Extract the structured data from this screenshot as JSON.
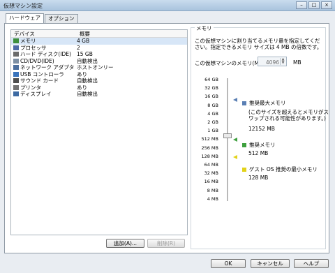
{
  "window": {
    "title": "仮想マシン設定",
    "minimize": "–",
    "maximize": "□",
    "close": "×"
  },
  "tabs": [
    {
      "label": "ハードウェア"
    },
    {
      "label": "オプション"
    }
  ],
  "devices": {
    "header": {
      "device": "デバイス",
      "summary": "概要"
    },
    "rows": [
      {
        "icon": "memory-icon",
        "device": "メモリ",
        "summary": "4 GB",
        "color": "#3e8f3e"
      },
      {
        "icon": "cpu-icon",
        "device": "プロセッサ",
        "summary": "2",
        "color": "#4e6aa7"
      },
      {
        "icon": "harddisk-icon",
        "device": "ハード ディスク(IDE)",
        "summary": "15 GB",
        "color": "#6b6b6b"
      },
      {
        "icon": "cd-dvd-icon",
        "device": "CD/DVD(IDE)",
        "summary": "自動検出",
        "color": "#7d8fa3"
      },
      {
        "icon": "network-adapter-icon",
        "device": "ネットワーク アダプタ",
        "summary": "ホストオンリー",
        "color": "#4d6f9d"
      },
      {
        "icon": "usb-icon",
        "device": "USB コントローラ",
        "summary": "あり",
        "color": "#3a74bc"
      },
      {
        "icon": "sound-card-icon",
        "device": "サウンド カード",
        "summary": "自動検出",
        "color": "#4f4f4f"
      },
      {
        "icon": "printer-icon",
        "device": "プリンタ",
        "summary": "あり",
        "color": "#737373"
      },
      {
        "icon": "display-icon",
        "device": "ディスプレイ",
        "summary": "自動検出",
        "color": "#3d6aa2"
      }
    ]
  },
  "buttons": {
    "add": "追加(A)...",
    "remove": "削除(R)",
    "ok": "OK",
    "cancel": "キャンセル",
    "help": "ヘルプ"
  },
  "memory": {
    "group_label": "メモリ",
    "description": "この仮想マシンに割り当てるメモリ量を指定してください。指定できるメモリ サイズは 4 MB の倍数です。",
    "field_label": "この仮想マシンのメモリ(M):",
    "field_value": "4096",
    "unit": "MB",
    "ticks": [
      "64 GB",
      "32 GB",
      "16 GB",
      "8 GB",
      "4 GB",
      "2 GB",
      "1 GB",
      "512 MB",
      "256 MB",
      "128 MB",
      "64 MB",
      "32 MB",
      "16 MB",
      "8 MB",
      "4 MB"
    ],
    "legend": {
      "max_recommended": {
        "label": "推奨最大メモリ",
        "note": "(このサイズを超えるとメモリがスワップされる可能性があります。)",
        "value": "12152 MB",
        "color": "#5a7fb4"
      },
      "recommended": {
        "label": "推奨メモリ",
        "value": "512 MB",
        "color": "#3ea03e"
      },
      "guest_min": {
        "label": "ゲスト OS 推奨の最小メモリ",
        "value": "128 MB",
        "color": "#e2d21a"
      }
    }
  }
}
